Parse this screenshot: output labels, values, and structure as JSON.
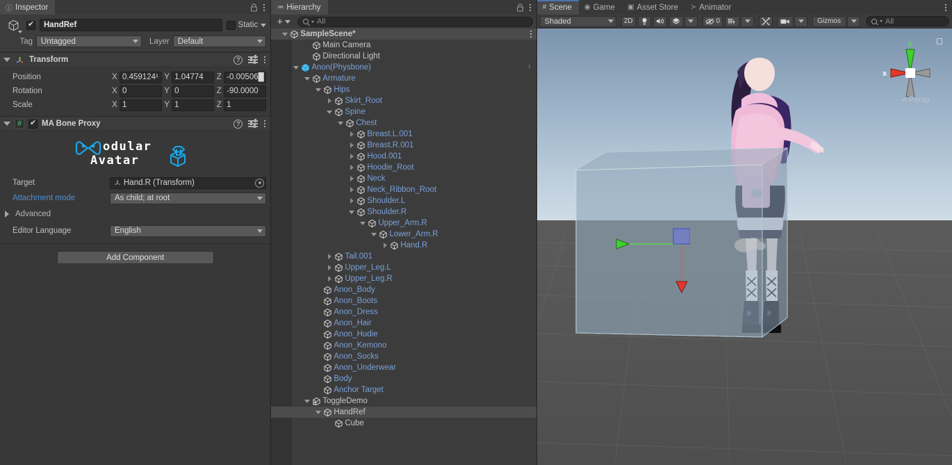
{
  "inspector": {
    "tab_label": "Inspector",
    "tab_icon": "info-icon",
    "lock_icon": "lock-icon",
    "menu_icon": "kebab-menu-icon",
    "gameobject": {
      "name": "HandRef",
      "enabled": true,
      "static_label": "Static",
      "tag_label": "Tag",
      "tag_value": "Untagged",
      "layer_label": "Layer",
      "layer_value": "Default"
    },
    "transform": {
      "title": "Transform",
      "rows": [
        {
          "label": "Position",
          "x": "0.459124¹",
          "y": "1.04774",
          "z": "-0.00506█"
        },
        {
          "label": "Rotation",
          "x": "0",
          "y": "0",
          "z": "-90.0000"
        },
        {
          "label": "Scale",
          "x": "1",
          "y": "1",
          "z": "1"
        }
      ],
      "axis_labels": [
        "X",
        "Y",
        "Z"
      ]
    },
    "bone_proxy": {
      "title": "MA Bone Proxy",
      "enabled": true,
      "logo_text_1": "odular",
      "logo_text_2": "vatar",
      "logo_mark_1": "M",
      "logo_mark_2": "A",
      "target_label": "Target",
      "target_value": "Hand.R (Transform)",
      "attachment_label": "Attachment mode",
      "attachment_value": "As child; at root",
      "advanced_label": "Advanced",
      "language_label": "Editor Language",
      "language_value": "English"
    },
    "add_component_label": "Add Component"
  },
  "hierarchy": {
    "tab_label": "Hierarchy",
    "add_label": "+",
    "search_placeholder": "All",
    "scene_name": "SampleScene*",
    "rows": [
      {
        "label": "SampleScene*",
        "depth": 0,
        "arrow": "open",
        "icon": "scene-icon",
        "color": "white",
        "scene": true
      },
      {
        "label": "Main Camera",
        "depth": 2,
        "arrow": "none",
        "icon": "gameobject-icon",
        "color": "white"
      },
      {
        "label": "Directional Light",
        "depth": 2,
        "arrow": "none",
        "icon": "gameobject-icon",
        "color": "white"
      },
      {
        "label": "Anon(Physbone)",
        "depth": 1,
        "arrow": "open",
        "icon": "prefab-icon",
        "color": "blue",
        "chevron": true
      },
      {
        "label": "Armature",
        "depth": 2,
        "arrow": "open",
        "icon": "gameobject-icon",
        "color": "blue"
      },
      {
        "label": "Hips",
        "depth": 3,
        "arrow": "open",
        "icon": "gameobject-icon",
        "color": "blue"
      },
      {
        "label": "Skirt_Root",
        "depth": 4,
        "arrow": "closed",
        "icon": "gameobject-icon",
        "color": "blue"
      },
      {
        "label": "Spine",
        "depth": 4,
        "arrow": "open",
        "icon": "gameobject-icon",
        "color": "blue"
      },
      {
        "label": "Chest",
        "depth": 5,
        "arrow": "open",
        "icon": "gameobject-icon",
        "color": "blue"
      },
      {
        "label": "Breast.L.001",
        "depth": 6,
        "arrow": "closed",
        "icon": "gameobject-icon",
        "color": "blue"
      },
      {
        "label": "Breast.R.001",
        "depth": 6,
        "arrow": "closed",
        "icon": "gameobject-icon",
        "color": "blue"
      },
      {
        "label": "Hood.001",
        "depth": 6,
        "arrow": "closed",
        "icon": "gameobject-icon",
        "color": "blue"
      },
      {
        "label": "Hoodie_Root",
        "depth": 6,
        "arrow": "closed",
        "icon": "gameobject-icon",
        "color": "blue"
      },
      {
        "label": "Neck",
        "depth": 6,
        "arrow": "closed",
        "icon": "gameobject-icon",
        "color": "blue"
      },
      {
        "label": "Neck_Ribbon_Root",
        "depth": 6,
        "arrow": "closed",
        "icon": "gameobject-icon",
        "color": "blue"
      },
      {
        "label": "Shoulder.L",
        "depth": 6,
        "arrow": "closed",
        "icon": "gameobject-icon",
        "color": "blue"
      },
      {
        "label": "Shoulder.R",
        "depth": 6,
        "arrow": "open",
        "icon": "gameobject-icon",
        "color": "blue"
      },
      {
        "label": "Upper_Arm.R",
        "depth": 7,
        "arrow": "open",
        "icon": "gameobject-icon",
        "color": "blue"
      },
      {
        "label": "Lower_Arm.R",
        "depth": 8,
        "arrow": "open",
        "icon": "gameobject-icon",
        "color": "blue"
      },
      {
        "label": "Hand.R",
        "depth": 9,
        "arrow": "closed",
        "icon": "gameobject-icon",
        "color": "blue"
      },
      {
        "label": "Tail.001",
        "depth": 4,
        "arrow": "closed",
        "icon": "gameobject-icon",
        "color": "blue"
      },
      {
        "label": "Upper_Leg.L",
        "depth": 4,
        "arrow": "closed",
        "icon": "gameobject-icon",
        "color": "blue"
      },
      {
        "label": "Upper_Leg.R",
        "depth": 4,
        "arrow": "closed",
        "icon": "gameobject-icon",
        "color": "blue"
      },
      {
        "label": "Anon_Body",
        "depth": 3,
        "arrow": "none",
        "icon": "gameobject-icon",
        "color": "blue"
      },
      {
        "label": "Anon_Boots",
        "depth": 3,
        "arrow": "none",
        "icon": "gameobject-icon",
        "color": "blue"
      },
      {
        "label": "Anon_Dress",
        "depth": 3,
        "arrow": "none",
        "icon": "gameobject-icon",
        "color": "blue"
      },
      {
        "label": "Anon_Hair",
        "depth": 3,
        "arrow": "none",
        "icon": "gameobject-icon",
        "color": "blue"
      },
      {
        "label": "Anon_Hudie",
        "depth": 3,
        "arrow": "none",
        "icon": "gameobject-icon",
        "color": "blue"
      },
      {
        "label": "Anon_Kemono",
        "depth": 3,
        "arrow": "none",
        "icon": "gameobject-icon",
        "color": "blue"
      },
      {
        "label": "Anon_Socks",
        "depth": 3,
        "arrow": "none",
        "icon": "gameobject-icon",
        "color": "blue"
      },
      {
        "label": "Anon_Underwear",
        "depth": 3,
        "arrow": "none",
        "icon": "gameobject-icon",
        "color": "blue"
      },
      {
        "label": "Body",
        "depth": 3,
        "arrow": "none",
        "icon": "gameobject-icon",
        "color": "blue"
      },
      {
        "label": "Anchor Target",
        "depth": 3,
        "arrow": "none",
        "icon": "gameobject-icon",
        "color": "blue"
      },
      {
        "label": "ToggleDemo",
        "depth": 2,
        "arrow": "open",
        "icon": "gameobject-add-icon",
        "color": "white"
      },
      {
        "label": "HandRef",
        "depth": 3,
        "arrow": "open",
        "icon": "gameobject-icon",
        "color": "white",
        "selected": true
      },
      {
        "label": "Cube",
        "depth": 4,
        "arrow": "none",
        "icon": "gameobject-icon",
        "color": "white"
      }
    ]
  },
  "scene": {
    "tabs": [
      {
        "label": "Scene",
        "icon": "grid-icon",
        "active": true
      },
      {
        "label": "Game",
        "icon": "gamepad-icon",
        "active": false
      },
      {
        "label": "Asset Store",
        "icon": "store-icon",
        "active": false
      },
      {
        "label": "Animator",
        "icon": "animator-icon",
        "active": false
      }
    ],
    "toolbar": {
      "shading_mode": "Shaded",
      "mode_2d": "2D",
      "lighting_icon": "lightbulb-icon",
      "audio_icon": "speaker-icon",
      "fx_icon": "effects-icon",
      "fx_caret": "chevron-down-icon",
      "visibility_icon": "eye-off-icon",
      "visibility_count": "0",
      "grid_icon": "grid-snap-icon",
      "grid_caret": "chevron-down-icon",
      "tools_icon": "tools-icon",
      "camera_icon": "camera-icon",
      "camera_caret": "chevron-down-icon",
      "gizmos_label": "Gizmos",
      "gizmos_caret": "chevron-down-icon",
      "search_placeholder": "All"
    },
    "gizmo": {
      "x_label": "x",
      "y_label": "y",
      "projection": "Persp",
      "lock_icon": "lock-open-icon"
    }
  }
}
